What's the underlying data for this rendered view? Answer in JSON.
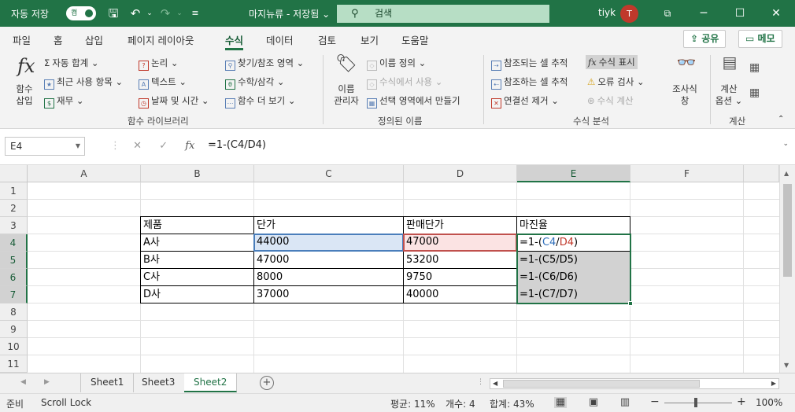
{
  "titlebar": {
    "autosave_label": "자동 저장",
    "autosave_state": "켬",
    "doc_title": "마지뉴류 - 저장됨",
    "doc_title_caret": "⌄",
    "search_placeholder": "검색",
    "user_name": "tiyk",
    "user_initial": "T"
  },
  "tabs": [
    "파일",
    "홈",
    "삽입",
    "페이지 레이아웃",
    "수식",
    "데이터",
    "검토",
    "보기",
    "도움말"
  ],
  "active_tab": "수식",
  "share_label": "공유",
  "memo_label": "메모",
  "ribbon": {
    "fx_label_1": "함수",
    "fx_label_2": "삽입",
    "autosum": "자동 합계",
    "recent": "최근 사용 항목",
    "finance": "재무",
    "logic": "논리",
    "text": "텍스트",
    "datetime": "날짜 및 시간",
    "lookup": "찾기/참조 영역",
    "math": "수학/삼각",
    "more": "함수 더 보기",
    "group_library": "함수 라이브러리",
    "name_mgr_1": "이름",
    "name_mgr_2": "관리자",
    "define_name": "이름 정의",
    "use_in_formula": "수식에서 사용",
    "create_from_sel": "선택 영역에서 만들기",
    "group_names": "정의된 이름",
    "trace_precedents": "참조되는 셀 추적",
    "trace_dependents": "참조하는 셀 추적",
    "remove_arrows": "연결선 제거",
    "show_formulas": "수식 표시",
    "error_check": "오류 검사",
    "evaluate": "수식 계산",
    "watch_1": "조사식",
    "watch_2": "창",
    "group_audit": "수식 분석",
    "calc_opts_1": "계산",
    "calc_opts_2": "옵션",
    "group_calc": "계산"
  },
  "formula_bar": {
    "name_box": "E4",
    "formula": "=1-(C4/D4)"
  },
  "columns": [
    "A",
    "B",
    "C",
    "D",
    "E",
    "F"
  ],
  "rows": [
    "1",
    "2",
    "3",
    "4",
    "5",
    "6",
    "7",
    "8",
    "9",
    "10",
    "11"
  ],
  "table": {
    "headers": [
      "제품",
      "단가",
      "판매단가",
      "마진율"
    ],
    "rows": [
      [
        "A사",
        "44000",
        "47000",
        "=1-(C4/D4)"
      ],
      [
        "B사",
        "47000",
        "53200",
        "=1-(C5/D5)"
      ],
      [
        "C사",
        "8000",
        "9750",
        "=1-(C6/D6)"
      ],
      [
        "D사",
        "37000",
        "40000",
        "=1-(C7/D7)"
      ]
    ],
    "e4_parts": [
      "=1-(",
      "C4",
      "/",
      "D4",
      ")"
    ]
  },
  "sheets": [
    "Sheet1",
    "Sheet3",
    "Sheet2"
  ],
  "active_sheet": "Sheet2",
  "status": {
    "ready": "준비",
    "scroll_lock": "Scroll Lock",
    "average": "평균: 11%",
    "count": "개수: 4",
    "sum": "합계: 43%",
    "zoom": "100%"
  },
  "colors": {
    "accent": "#217346",
    "ref_c4": "#2f6fbb",
    "ref_d4": "#c0392b"
  }
}
